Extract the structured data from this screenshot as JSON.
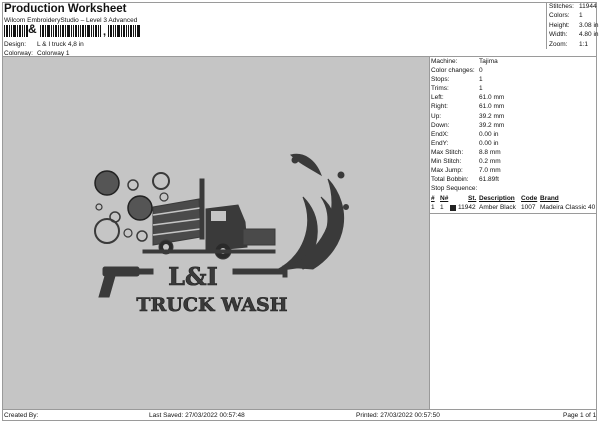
{
  "header": {
    "title": "Production Worksheet",
    "subtitle": "Wilcom EmbroideryStudio – Level 3 Advanced",
    "barcode_label": "&",
    "barcode_suffix": ","
  },
  "design": {
    "design_label": "Design:",
    "design_value": "L & I truck 4,8 in",
    "colorway_label": "Colorway:",
    "colorway_value": "Colorway 1"
  },
  "stats": [
    {
      "label": "Stitches:",
      "value": "11944"
    },
    {
      "label": "Colors:",
      "value": "1"
    },
    {
      "label": "Height:",
      "value": "3.08 in"
    },
    {
      "label": "Width:",
      "value": "4.80 in"
    },
    {
      "label": "Zoom:",
      "value": "1:1"
    }
  ],
  "machine_info": [
    {
      "label": "Machine:",
      "value": "Tajima"
    },
    {
      "label": "Color changes:",
      "value": "0"
    },
    {
      "label": "Stops:",
      "value": "1"
    },
    {
      "label": "Trims:",
      "value": "1"
    },
    {
      "label": "Left:",
      "value": "61.0 mm"
    },
    {
      "label": "Right:",
      "value": "61.0 mm"
    },
    {
      "label": "Up:",
      "value": "39.2 mm"
    },
    {
      "label": "Down:",
      "value": "39.2 mm"
    },
    {
      "label": "EndX:",
      "value": "0.00 in"
    },
    {
      "label": "EndY:",
      "value": "0.00 in"
    },
    {
      "label": "Max Stitch:",
      "value": "8.8 mm"
    },
    {
      "label": "Min Stitch:",
      "value": "0.2 mm"
    },
    {
      "label": "Max Jump:",
      "value": "7.0 mm"
    },
    {
      "label": "Total Bobbin:",
      "value": "61.89ft"
    }
  ],
  "stop_sequence": {
    "title": "Stop Sequence:",
    "headers": [
      "#",
      "N#",
      "St.",
      "Description",
      "Code",
      "Brand"
    ],
    "rows": [
      {
        "num": "1",
        "needle": "1",
        "color": "#222222",
        "stitches": "11942",
        "description": "Amber Black",
        "code": "1007",
        "brand": "Madeira Classic 40"
      }
    ]
  },
  "design_preview": {
    "logo_line1": "L&I",
    "logo_line2": "TRUCK WASH",
    "thread_color": "#3a3a3a",
    "background": "#c5c5c5"
  },
  "footer": {
    "created_by": "Created By:",
    "last_saved": "Last Saved: 27/03/2022 00:57:48",
    "printed": "Printed: 27/03/2022 00:57:50",
    "page": "Page 1 of 1"
  }
}
